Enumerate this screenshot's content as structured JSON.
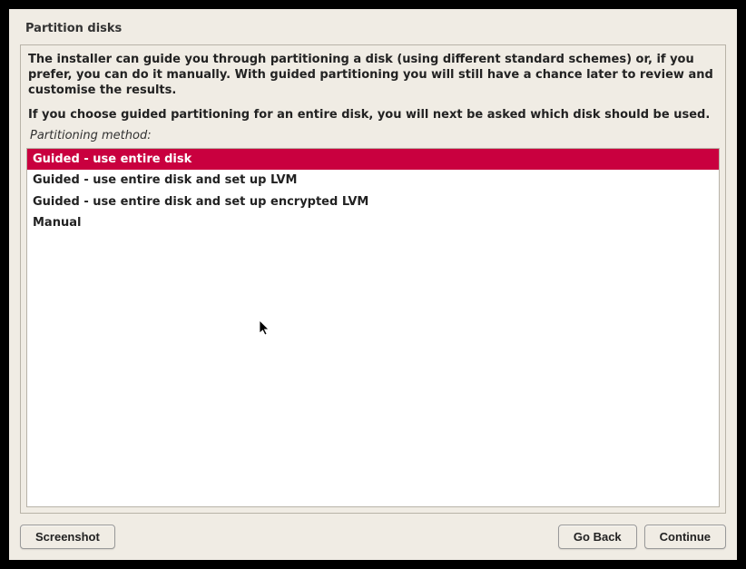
{
  "title": "Partition disks",
  "intro1": "The installer can guide you through partitioning a disk (using different standard schemes) or, if you prefer, you can do it manually. With guided partitioning you will still have a chance later to review and customise the results.",
  "intro2": "If you choose guided partitioning for an entire disk, you will next be asked which disk should be used.",
  "prompt_label": "Partitioning method:",
  "options": [
    {
      "label": "Guided - use entire disk",
      "selected": true
    },
    {
      "label": "Guided - use entire disk and set up LVM",
      "selected": false
    },
    {
      "label": "Guided - use entire disk and set up encrypted LVM",
      "selected": false
    },
    {
      "label": "Manual",
      "selected": false
    }
  ],
  "buttons": {
    "screenshot": "Screenshot",
    "go_back": "Go Back",
    "continue": "Continue"
  }
}
